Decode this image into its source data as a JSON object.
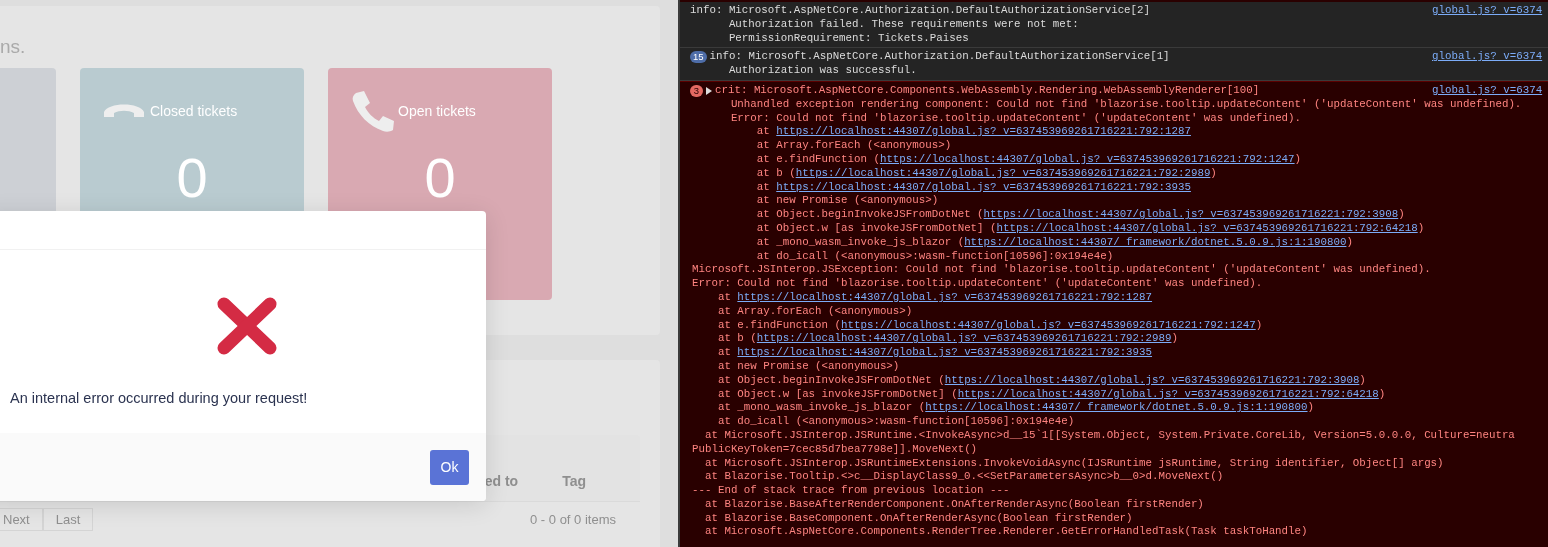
{
  "page": {
    "intro_text": "ns.",
    "stat_cards": [
      {
        "color": "#cdd0d5"
      },
      {
        "color": "#b9cbd0",
        "kind": "phone-down",
        "label": "Closed tickets",
        "value": "0"
      },
      {
        "color": "#d9a9b2",
        "kind": "phone",
        "label": "Open tickets",
        "value": "0"
      }
    ],
    "table": {
      "columns": [
        "ed to",
        "Tag"
      ]
    },
    "pagination": [
      "Next",
      "Last"
    ],
    "items_summary": "0 - 0 of 0 items"
  },
  "modal": {
    "kind": "error",
    "message": "An internal error occurred during your request!",
    "buttons": [
      "Ok"
    ]
  },
  "console": {
    "entries": [
      {
        "kind": "info",
        "source": "global.js? v=6374",
        "lines": [
          {
            "kind": "header",
            "text": "info: Microsoft.AspNetCore.Authorization.DefaultAuthorizationService[2]"
          },
          {
            "kind": "message",
            "text": "Authorization failed. These requirements were not met:"
          },
          {
            "kind": "message",
            "text": "PermissionRequirement: Tickets.Paises"
          }
        ]
      },
      {
        "kind": "info",
        "count": "15",
        "source": "global.js? v=6374",
        "lines": [
          {
            "kind": "header",
            "text": "info: Microsoft.AspNetCore.Authorization.DefaultAuthorizationService[1]"
          },
          {
            "kind": "message",
            "text": "Authorization was successful."
          }
        ]
      },
      {
        "kind": "crit",
        "count": "3",
        "expanded": false,
        "source": "global.js? v=6374",
        "lines": [
          {
            "kind": "header",
            "text": "crit: Microsoft.AspNetCore.Components.WebAssembly.Rendering.WebAssemblyRenderer[100]"
          },
          {
            "kind": "message",
            "text": "Unhandled exception rendering component: Could not find 'blazorise.tooltip.updateContent' ('updateContent' was undefined)."
          },
          {
            "kind": "message",
            "text": "Error: Could not find 'blazorise.tooltip.updateContent' ('updateContent' was undefined)."
          },
          {
            "kind": "frame",
            "text": "at ",
            "link": "https://localhost:44307/global.js? v=637453969261716221:792:1287"
          },
          {
            "kind": "frame",
            "text": "at Array.forEach (<anonymous>)"
          },
          {
            "kind": "frame",
            "text": "at e.findFunction (",
            "link": "https://localhost:44307/global.js? v=637453969261716221:792:1247",
            "post": ")"
          },
          {
            "kind": "frame",
            "text": "at b (",
            "link": "https://localhost:44307/global.js? v=637453969261716221:792:2989",
            "post": ")"
          },
          {
            "kind": "frame",
            "text": "at ",
            "link": "https://localhost:44307/global.js? v=637453969261716221:792:3935"
          },
          {
            "kind": "frame",
            "text": "at new Promise (<anonymous>)"
          },
          {
            "kind": "frame",
            "text": "at Object.beginInvokeJSFromDotNet (",
            "link": "https://localhost:44307/global.js? v=637453969261716221:792:3908",
            "post": ")"
          },
          {
            "kind": "frame",
            "text": "at Object.w [as invokeJSFromDotNet] (",
            "link": "https://localhost:44307/global.js? v=637453969261716221:792:64218",
            "post": ")"
          },
          {
            "kind": "frame",
            "text": "at _mono_wasm_invoke_js_blazor (",
            "link": "https://localhost:44307/ framework/dotnet.5.0.9.js:1:190800",
            "post": ")"
          },
          {
            "kind": "frame",
            "text": "at do_icall (<anonymous>:wasm-function[10596]:0x194e4e)"
          },
          {
            "kind": "exception",
            "text": "Microsoft.JSInterop.JSException: Could not find 'blazorise.tooltip.updateContent' ('updateContent' was undefined)."
          },
          {
            "kind": "exception",
            "text": "Error: Could not find 'blazorise.tooltip.updateContent' ('updateContent' was undefined)."
          },
          {
            "kind": "outer-frame",
            "text": "at ",
            "link": "https://localhost:44307/global.js? v=637453969261716221:792:1287"
          },
          {
            "kind": "outer-frame",
            "text": "at Array.forEach (<anonymous>)"
          },
          {
            "kind": "outer-frame",
            "text": "at e.findFunction (",
            "link": "https://localhost:44307/global.js? v=637453969261716221:792:1247",
            "post": ")"
          },
          {
            "kind": "outer-frame",
            "text": "at b (",
            "link": "https://localhost:44307/global.js? v=637453969261716221:792:2989",
            "post": ")"
          },
          {
            "kind": "outer-frame",
            "text": "at ",
            "link": "https://localhost:44307/global.js? v=637453969261716221:792:3935"
          },
          {
            "kind": "outer-frame",
            "text": "at new Promise (<anonymous>)"
          },
          {
            "kind": "outer-frame",
            "text": "at Object.beginInvokeJSFromDotNet (",
            "link": "https://localhost:44307/global.js? v=637453969261716221:792:3908",
            "post": ")"
          },
          {
            "kind": "outer-frame",
            "text": "at Object.w [as invokeJSFromDotNet] (",
            "link": "https://localhost:44307/global.js? v=637453969261716221:792:64218",
            "post": ")"
          },
          {
            "kind": "outer-frame",
            "text": "at _mono_wasm_invoke_js_blazor (",
            "link": "https://localhost:44307/ framework/dotnet.5.0.9.js:1:190800",
            "post": ")"
          },
          {
            "kind": "outer-frame",
            "text": "at do_icall (<anonymous>:wasm-function[10596]:0x194e4e)"
          },
          {
            "kind": "clr-frame",
            "text": "at Microsoft.JSInterop.JSRuntime.<InvokeAsync>d__15`1[[System.Object, System.Private.CoreLib, Version=5.0.0.0, Culture=neutra"
          },
          {
            "kind": "exception",
            "text": "PublicKeyToken=7cec85d7bea7798e]].MoveNext()"
          },
          {
            "kind": "clr-frame",
            "text": "at Microsoft.JSInterop.JSRuntimeExtensions.InvokeVoidAsync(IJSRuntime jsRuntime, String identifier, Object[] args)"
          },
          {
            "kind": "clr-frame",
            "text": "at Blazorise.Tooltip.<>c__DisplayClass9_0.<<SetParametersAsync>b__0>d.MoveNext()"
          },
          {
            "kind": "exception",
            "text": "--- End of stack trace from previous location ---"
          },
          {
            "kind": "clr-frame",
            "text": "at Blazorise.BaseAfterRenderComponent.OnAfterRenderAsync(Boolean firstRender)"
          },
          {
            "kind": "clr-frame",
            "text": "at Blazorise.BaseComponent.OnAfterRenderAsync(Boolean firstRender)"
          },
          {
            "kind": "clr-frame",
            "text": "at Microsoft.AspNetCore.Components.RenderTree.Renderer.GetErrorHandledTask(Task taskToHandle)"
          }
        ]
      }
    ]
  }
}
